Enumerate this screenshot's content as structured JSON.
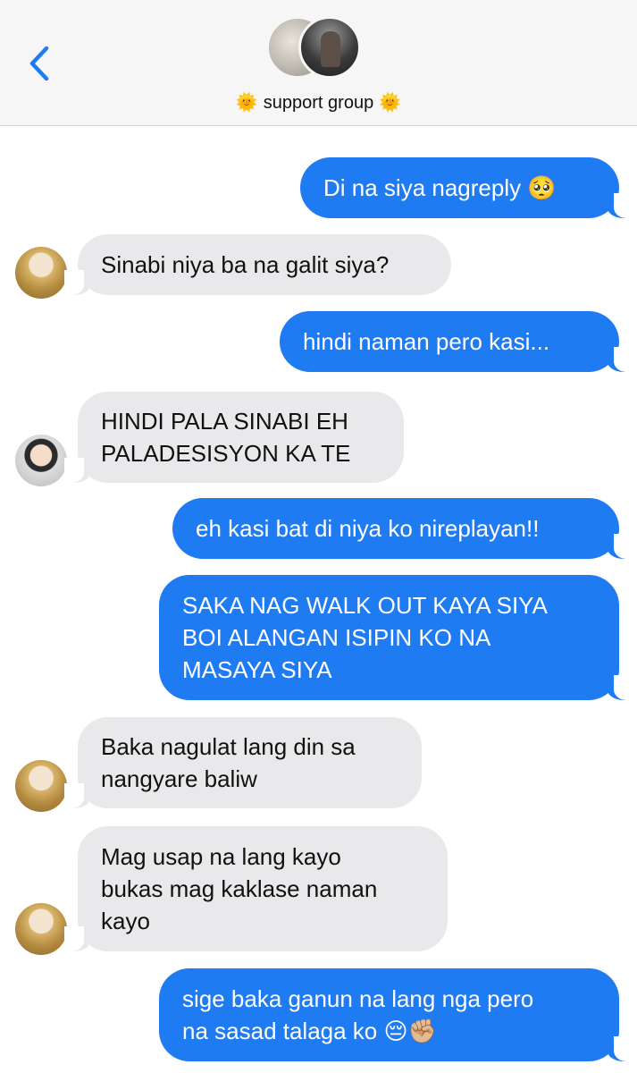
{
  "header": {
    "back_label": "<",
    "title": "support group",
    "title_emoji": "🌞",
    "avatars": [
      "group-avatar-1",
      "group-avatar-2"
    ]
  },
  "colors": {
    "outgoing": "#1f7bf2",
    "incoming": "#e9e9eb",
    "header_bg": "#f6f6f6",
    "accent": "#1f7bf2"
  },
  "messages": [
    {
      "direction": "outgoing",
      "text": "Di na siya nagreply 🥺"
    },
    {
      "direction": "incoming",
      "sender_avatar": "avatar-a",
      "text": "Sinabi niya ba na galit siya?"
    },
    {
      "direction": "outgoing",
      "text": "hindi naman pero kasi..."
    },
    {
      "direction": "incoming",
      "sender_avatar": "avatar-b",
      "text": "HINDI PALA SINABI EH\nPALADESISYON KA TE"
    },
    {
      "direction": "outgoing",
      "text": "eh kasi bat di niya ko nireplayan!!"
    },
    {
      "direction": "outgoing",
      "text": "SAKA NAG WALK OUT KAYA SIYA\nBOI ALANGAN ISIPIN KO NA\nMASAYA SIYA"
    },
    {
      "direction": "incoming",
      "sender_avatar": "avatar-a",
      "text": "Baka nagulat lang din sa\nnangyare baliw"
    },
    {
      "direction": "incoming",
      "sender_avatar": "avatar-a",
      "text": "Mag usap na lang kayo\nbukas mag kaklase naman\nkayo"
    },
    {
      "direction": "outgoing",
      "text": "sige baka ganun na lang nga pero\nna sasad talaga ko 😔✊🏼"
    }
  ]
}
